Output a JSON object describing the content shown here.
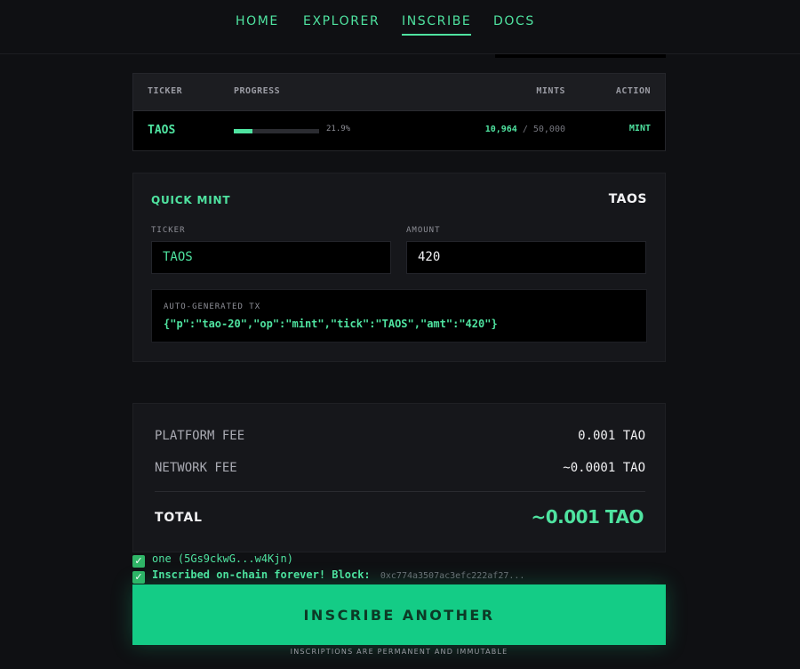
{
  "nav": {
    "items": [
      {
        "label": "HOME"
      },
      {
        "label": "EXPLORER"
      },
      {
        "label": "INSCRIBE"
      },
      {
        "label": "DOCS"
      }
    ],
    "active": "INSCRIBE"
  },
  "table": {
    "headers": {
      "ticker": "TICKER",
      "progress": "PROGRESS",
      "mints": "MINTS",
      "action": "ACTION"
    },
    "row": {
      "ticker": "TAOS",
      "progress_fraction": 0.219,
      "progress_pct": "21.9%",
      "mints_current": "10,964",
      "mints_sep": " / ",
      "mints_total": "50,000",
      "action": "MINT"
    }
  },
  "quick_mint": {
    "title": "QUICK MINT",
    "selected_ticker": "TAOS",
    "ticker_label": "TICKER",
    "ticker_value": "TAOS",
    "amount_label": "AMOUNT",
    "amount_value": "420",
    "tx_label": "AUTO-GENERATED TX",
    "tx_json": "{\"p\":\"tao-20\",\"op\":\"mint\",\"tick\":\"TAOS\",\"amt\":\"420\"}"
  },
  "fees": {
    "platform_label": "PLATFORM FEE",
    "platform_value": "0.001 TAO",
    "network_label": "NETWORK FEE",
    "network_value": "~0.0001 TAO",
    "total_label": "TOTAL",
    "total_value": "~0.001 TAO"
  },
  "status": {
    "line1": "one (5Gs9ckwG...w4Kjn)",
    "line2_bold": "Inscribed on-chain forever!",
    "line2_block": " Block: ",
    "line2_hash": "0xc774a3507ac3efc222af27..."
  },
  "cta": {
    "label": "INSCRIBE ANOTHER"
  },
  "footer": {
    "note": "INSCRIPTIONS ARE PERMANENT AND IMMUTABLE"
  },
  "colors": {
    "accent": "#4fe3a0",
    "cta_bg": "#14cc86",
    "bg": "#0f1013"
  }
}
